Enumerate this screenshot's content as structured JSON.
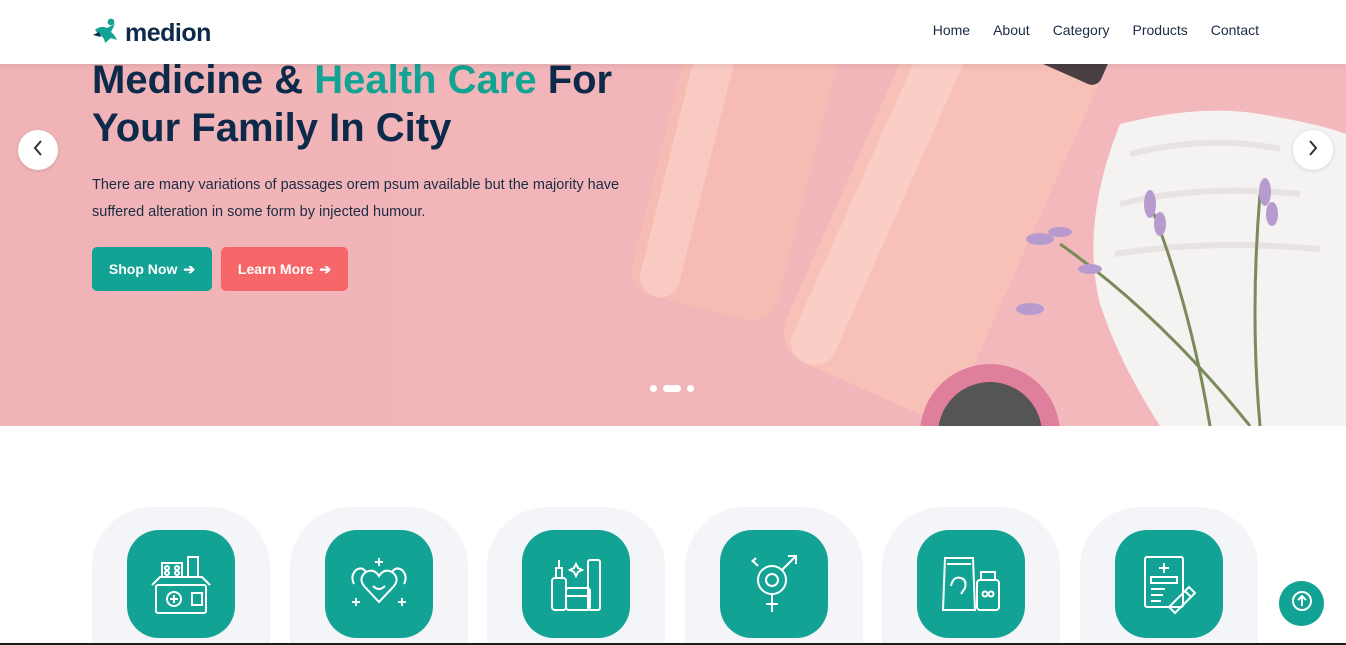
{
  "brand": {
    "name": "medion",
    "logo_icon": "medion-logo-icon",
    "primary_color": "#13a394",
    "accent_color": "#f7676a",
    "dark_color": "#0d2a4a"
  },
  "nav": {
    "items": [
      {
        "label": "Home"
      },
      {
        "label": "About"
      },
      {
        "label": "Category"
      },
      {
        "label": "Products"
      },
      {
        "label": "Contact"
      }
    ]
  },
  "hero": {
    "title_part1": "Medicine & ",
    "title_accent": "Health Care",
    "title_part2": " For",
    "title_line2": "Your Family In City",
    "description": "There are many variations of passages orem psum available but the majority have suffered alteration in some form by injected humour.",
    "shop_button": "Shop Now",
    "learn_button": "Learn More",
    "slides_count": 3,
    "active_slide": 2
  },
  "categories": {
    "items": [
      {
        "icon": "medicine-box-icon"
      },
      {
        "icon": "healthy-heart-icon"
      },
      {
        "icon": "skincare-products-icon"
      },
      {
        "icon": "gender-symbols-icon"
      },
      {
        "icon": "supplements-icon"
      },
      {
        "icon": "prescription-icon"
      }
    ]
  },
  "scroll_top": {
    "icon": "arrow-up-icon"
  }
}
